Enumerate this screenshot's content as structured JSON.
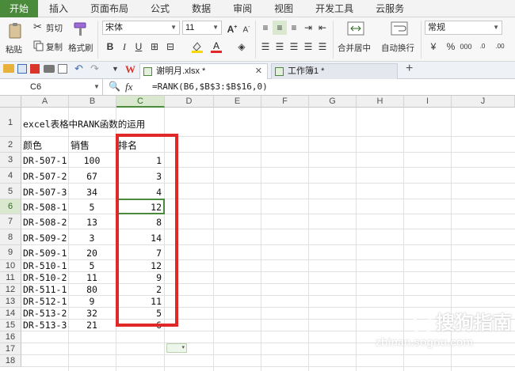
{
  "ribbon_tabs": [
    "开始",
    "插入",
    "页面布局",
    "公式",
    "数据",
    "审阅",
    "视图",
    "开发工具",
    "云服务"
  ],
  "ribbon": {
    "paste": "粘贴",
    "cut": "剪切",
    "copy": "复制",
    "format_painter": "格式刷",
    "font_name": "宋体",
    "font_size": "11",
    "merge_center": "合并居中",
    "wrap_text": "自动换行",
    "number_format": "常规",
    "percent": "%",
    "thousands": "000"
  },
  "doc_tabs": [
    {
      "label": "谢明月.xlsx *",
      "active": true
    },
    {
      "label": "工作簿1 *",
      "active": false
    }
  ],
  "name_box": "C6",
  "fx_label": "fx",
  "formula": "=RANK(B6,$B$3:$B$16,0)",
  "columns": [
    "A",
    "B",
    "C",
    "D",
    "E",
    "F",
    "G",
    "H",
    "I",
    "J"
  ],
  "rows": [
    "1",
    "2",
    "3",
    "4",
    "5",
    "6",
    "7",
    "8",
    "9",
    "10",
    "11",
    "12",
    "13",
    "14",
    "15",
    "16",
    "17",
    "18"
  ],
  "sheet": {
    "title": "excel表格中RANK函数的运用",
    "headers": [
      "颜色",
      "销售",
      "排名"
    ],
    "data": [
      [
        "DR-507-1",
        "100",
        "1"
      ],
      [
        "DR-507-2",
        "67",
        "3"
      ],
      [
        "DR-507-3",
        "34",
        "4"
      ],
      [
        "DR-508-1",
        "5",
        "12"
      ],
      [
        "DR-508-2",
        "13",
        "8"
      ],
      [
        "DR-509-2",
        "3",
        "14"
      ],
      [
        "DR-509-1",
        "20",
        "7"
      ],
      [
        "DR-510-1",
        "5",
        "12"
      ],
      [
        "DR-510-2",
        "11",
        "9"
      ],
      [
        "DR-511-1",
        "80",
        "2"
      ],
      [
        "DR-512-1",
        "9",
        "11"
      ],
      [
        "DR-513-2",
        "32",
        "5"
      ],
      [
        "DR-513-3",
        "21",
        "6"
      ]
    ]
  },
  "watermark": {
    "brand": "搜狗指南",
    "url": "zhinan.sogou.com"
  },
  "colors": {
    "accent": "#4a8b3b",
    "highlight_box": "#e02828"
  }
}
